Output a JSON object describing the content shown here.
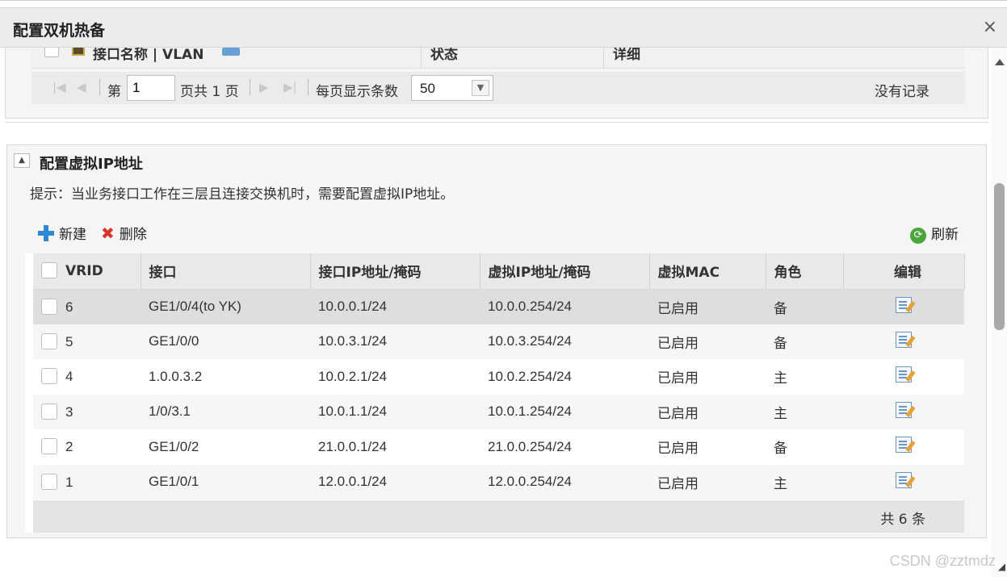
{
  "dialog": {
    "title": "配置双机热备",
    "close_label": "×"
  },
  "top_panel": {
    "columns": [
      "接口名称 | VLAN",
      "状态",
      "详细"
    ],
    "pager": {
      "first": "|◀",
      "prev": "◀",
      "page_prefix": "第",
      "page_value": "1",
      "page_suffix": "页共 1 页",
      "next": "▶",
      "last": "▶|",
      "per_page_label": "每页显示条数",
      "per_page_value": "50",
      "no_records": "没有记录"
    }
  },
  "vip_panel": {
    "collapse_icon": "▲",
    "title": "配置虚拟IP地址",
    "hint": "提示：当业务接口工作在三层且连接交换机时，需要配置虚拟IP地址。",
    "toolbar": {
      "new_label": "新建",
      "delete_label": "删除",
      "refresh_label": "刷新"
    },
    "columns": [
      "VRID",
      "接口",
      "接口IP地址/掩码",
      "虚拟IP地址/掩码",
      "虚拟MAC",
      "角色",
      "编辑"
    ],
    "rows": [
      {
        "vrid": "6",
        "iface": "GE1/0/4(to YK)",
        "iface_ip": "10.0.0.1/24",
        "vip": "10.0.0.254/24",
        "vmac": "已启用",
        "role": "备"
      },
      {
        "vrid": "5",
        "iface": "GE1/0/0",
        "iface_ip": "10.0.3.1/24",
        "vip": "10.0.3.254/24",
        "vmac": "已启用",
        "role": "备"
      },
      {
        "vrid": "4",
        "iface": "1.0.0.3.2",
        "iface_ip": "10.0.2.1/24",
        "vip": "10.0.2.254/24",
        "vmac": "已启用",
        "role": "主"
      },
      {
        "vrid": "3",
        "iface": "1/0/3.1",
        "iface_ip": "10.0.1.1/24",
        "vip": "10.0.1.254/24",
        "vmac": "已启用",
        "role": "主"
      },
      {
        "vrid": "2",
        "iface": "GE1/0/2",
        "iface_ip": "21.0.0.1/24",
        "vip": "21.0.0.254/24",
        "vmac": "已启用",
        "role": "备"
      },
      {
        "vrid": "1",
        "iface": "GE1/0/1",
        "iface_ip": "12.0.0.1/24",
        "vip": "12.0.0.254/24",
        "vmac": "已启用",
        "role": "主"
      }
    ],
    "total": "共 6 条"
  },
  "watermark": "CSDN @zztmdz"
}
